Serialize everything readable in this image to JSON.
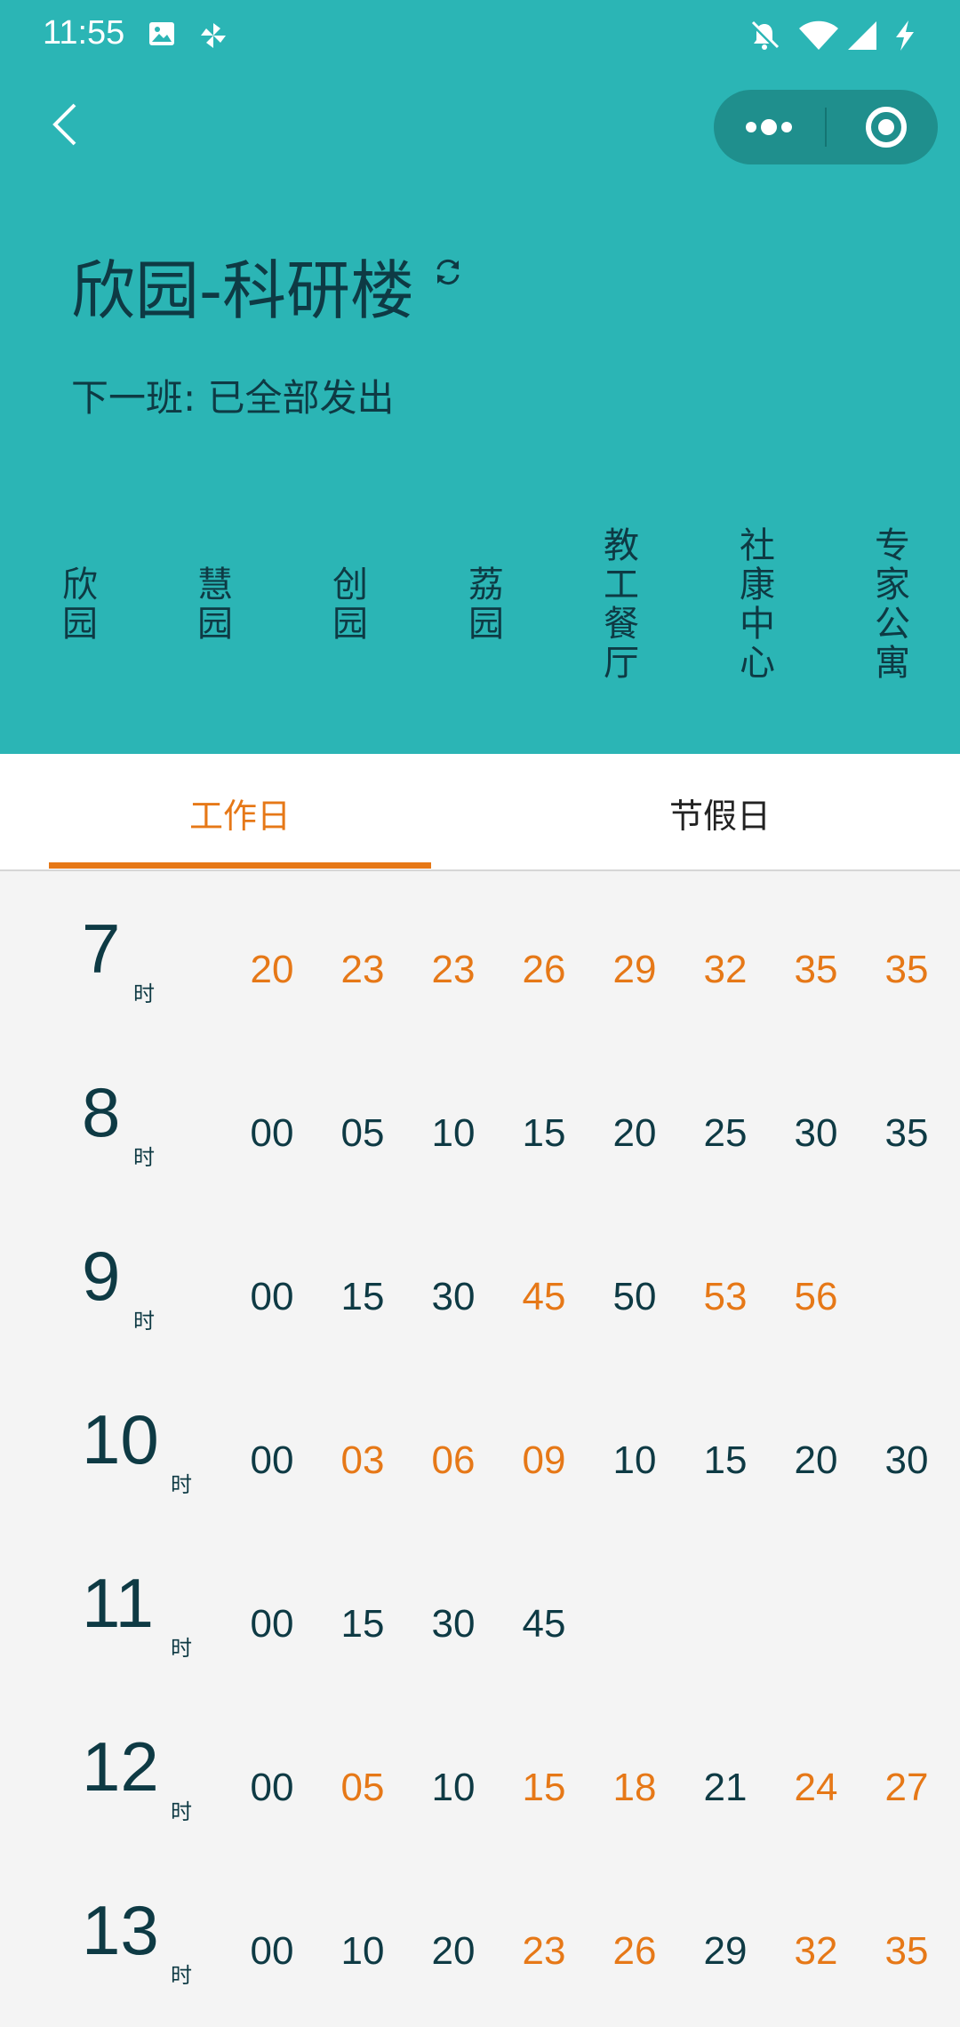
{
  "statusbar": {
    "time": "11:55",
    "left_icons": [
      "image-icon",
      "pinwheel-icon"
    ],
    "right_icons": [
      "bell-off-icon",
      "wifi-icon",
      "signal-icon",
      "charging-icon"
    ]
  },
  "nav": {
    "back_icon": "chevron-left-icon",
    "capsule_icons": [
      "more-dots-icon",
      "target-icon"
    ]
  },
  "page": {
    "title": "欣园-科研楼",
    "refresh_icon": "refresh-icon",
    "next_bus": "下一班: 已全部发出"
  },
  "stops": [
    "欣园",
    "慧园",
    "创园",
    "荔园",
    "教工餐厅",
    "社康中心",
    "专家公寓"
  ],
  "tabs": [
    {
      "label": "工作日",
      "active": true
    },
    {
      "label": "节假日",
      "active": false
    }
  ],
  "colors": {
    "header_bg": "#2bb5b5",
    "accent_orange": "#e67817",
    "text_dark": "#0e3a44",
    "capsule_bg": "#1f8f8d"
  },
  "hour_unit": "时",
  "schedule": [
    {
      "hour": "7",
      "minutes": [
        {
          "m": "20",
          "hl": true
        },
        {
          "m": "23",
          "hl": true
        },
        {
          "m": "23",
          "hl": true
        },
        {
          "m": "26",
          "hl": true
        },
        {
          "m": "29",
          "hl": true
        },
        {
          "m": "32",
          "hl": true
        },
        {
          "m": "35",
          "hl": true
        },
        {
          "m": "35",
          "hl": true
        }
      ]
    },
    {
      "hour": "8",
      "minutes": [
        {
          "m": "00",
          "hl": false
        },
        {
          "m": "05",
          "hl": false
        },
        {
          "m": "10",
          "hl": false
        },
        {
          "m": "15",
          "hl": false
        },
        {
          "m": "20",
          "hl": false
        },
        {
          "m": "25",
          "hl": false
        },
        {
          "m": "30",
          "hl": false
        },
        {
          "m": "35",
          "hl": false
        }
      ]
    },
    {
      "hour": "9",
      "minutes": [
        {
          "m": "00",
          "hl": false
        },
        {
          "m": "15",
          "hl": false
        },
        {
          "m": "30",
          "hl": false
        },
        {
          "m": "45",
          "hl": true
        },
        {
          "m": "50",
          "hl": false
        },
        {
          "m": "53",
          "hl": true
        },
        {
          "m": "56",
          "hl": true
        }
      ]
    },
    {
      "hour": "10",
      "minutes": [
        {
          "m": "00",
          "hl": false
        },
        {
          "m": "03",
          "hl": true
        },
        {
          "m": "06",
          "hl": true
        },
        {
          "m": "09",
          "hl": true
        },
        {
          "m": "10",
          "hl": false
        },
        {
          "m": "15",
          "hl": false
        },
        {
          "m": "20",
          "hl": false
        },
        {
          "m": "30",
          "hl": false
        }
      ]
    },
    {
      "hour": "11",
      "minutes": [
        {
          "m": "00",
          "hl": false
        },
        {
          "m": "15",
          "hl": false
        },
        {
          "m": "30",
          "hl": false
        },
        {
          "m": "45",
          "hl": false
        }
      ]
    },
    {
      "hour": "12",
      "minutes": [
        {
          "m": "00",
          "hl": false
        },
        {
          "m": "05",
          "hl": true
        },
        {
          "m": "10",
          "hl": false
        },
        {
          "m": "15",
          "hl": true
        },
        {
          "m": "18",
          "hl": true
        },
        {
          "m": "21",
          "hl": false
        },
        {
          "m": "24",
          "hl": true
        },
        {
          "m": "27",
          "hl": true
        }
      ]
    },
    {
      "hour": "13",
      "minutes": [
        {
          "m": "00",
          "hl": false
        },
        {
          "m": "10",
          "hl": false
        },
        {
          "m": "20",
          "hl": false
        },
        {
          "m": "23",
          "hl": true
        },
        {
          "m": "26",
          "hl": true
        },
        {
          "m": "29",
          "hl": false
        },
        {
          "m": "32",
          "hl": true
        },
        {
          "m": "35",
          "hl": true
        }
      ]
    }
  ]
}
